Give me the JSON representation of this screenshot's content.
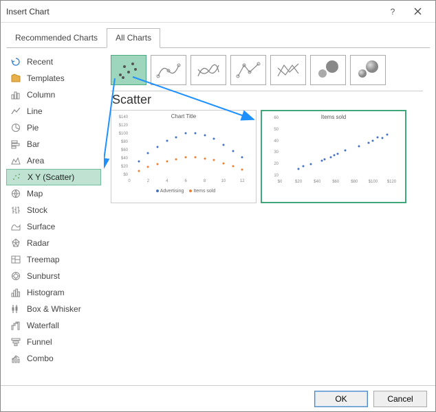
{
  "dialog": {
    "title": "Insert Chart"
  },
  "tabs": {
    "recommended": "Recommended Charts",
    "all": "All Charts"
  },
  "sidebar": {
    "items": [
      {
        "label": "Recent"
      },
      {
        "label": "Templates"
      },
      {
        "label": "Column"
      },
      {
        "label": "Line"
      },
      {
        "label": "Pie"
      },
      {
        "label": "Bar"
      },
      {
        "label": "Area"
      },
      {
        "label": "X Y (Scatter)"
      },
      {
        "label": "Map"
      },
      {
        "label": "Stock"
      },
      {
        "label": "Surface"
      },
      {
        "label": "Radar"
      },
      {
        "label": "Treemap"
      },
      {
        "label": "Sunburst"
      },
      {
        "label": "Histogram"
      },
      {
        "label": "Box & Whisker"
      },
      {
        "label": "Waterfall"
      },
      {
        "label": "Funnel"
      },
      {
        "label": "Combo"
      }
    ]
  },
  "subtype_name": "Scatter",
  "previews": {
    "p0": {
      "title": "Chart Title",
      "legend_a": "Advertising",
      "legend_b": "Items sold"
    },
    "p1": {
      "title": "Items sold"
    }
  },
  "footer": {
    "ok": "OK",
    "cancel": "Cancel"
  },
  "chart_data": [
    {
      "type": "scatter",
      "title": "Chart Title",
      "xlabel": "",
      "ylabel": "",
      "xlim": [
        0,
        13
      ],
      "ylim": [
        0,
        140
      ],
      "x_ticks": [
        0,
        2,
        4,
        6,
        8,
        10,
        12
      ],
      "y_ticks": [
        "$0",
        "$20",
        "$40",
        "$60",
        "$80",
        "$100",
        "$120",
        "$140"
      ],
      "series": [
        {
          "name": "Advertising",
          "color": "#4472C4",
          "x": [
            1,
            2,
            3,
            4,
            5,
            6,
            7,
            8,
            9,
            10,
            11,
            12
          ],
          "y": [
            45,
            65,
            80,
            95,
            105,
            115,
            115,
            110,
            100,
            85,
            70,
            55
          ]
        },
        {
          "name": "Items sold",
          "color": "#ED7D31",
          "x": [
            1,
            2,
            3,
            4,
            5,
            6,
            7,
            8,
            9,
            10,
            11,
            12
          ],
          "y": [
            20,
            30,
            38,
            45,
            50,
            55,
            55,
            52,
            47,
            40,
            32,
            24
          ]
        }
      ]
    },
    {
      "type": "scatter",
      "title": "Items sold",
      "xlabel": "",
      "ylabel": "",
      "xlim": [
        0,
        130
      ],
      "ylim": [
        10,
        60
      ],
      "x_ticks": [
        "$0",
        "$20",
        "$40",
        "$60",
        "$80",
        "$100",
        "$120"
      ],
      "y_ticks": [
        10,
        20,
        30,
        40,
        50,
        60
      ],
      "series": [
        {
          "name": "Items sold",
          "color": "#4472C4",
          "x": [
            20,
            25,
            33,
            45,
            48,
            55,
            58,
            62,
            70,
            85,
            95,
            100,
            105,
            110,
            115
          ],
          "y": [
            20,
            22,
            24,
            27,
            28,
            30,
            32,
            33,
            36,
            40,
            43,
            45,
            48,
            47,
            50
          ]
        }
      ]
    }
  ]
}
